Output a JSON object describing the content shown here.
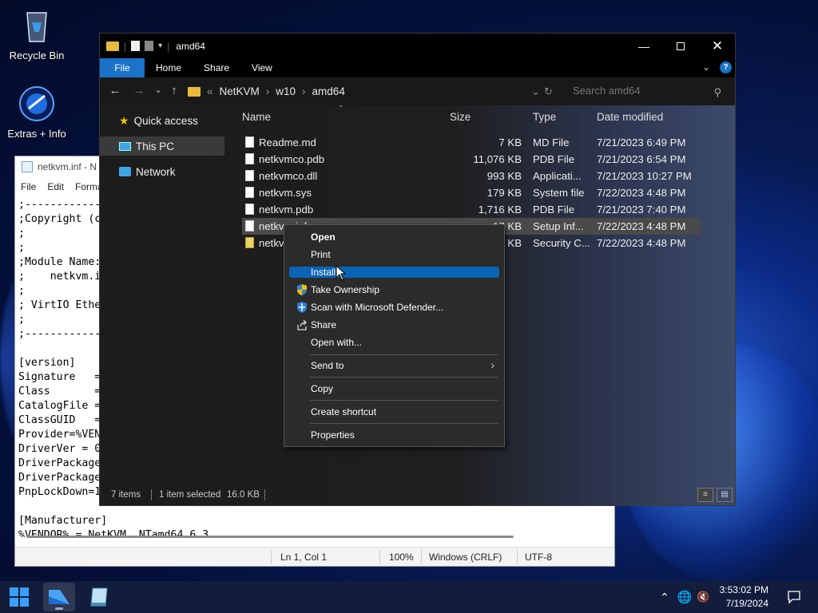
{
  "desktop": {
    "icons": [
      {
        "label": "Recycle Bin"
      },
      {
        "label": "Extras + Info"
      }
    ]
  },
  "notepad": {
    "title": "netkvm.inf - N",
    "menu": [
      "File",
      "Edit",
      "Forma"
    ],
    "lines": [
      ";-------------",
      ";Copyright (c",
      ";",
      ";",
      ";Module Name:",
      ";    netkvm.i",
      ";",
      "; VirtIO Ethe",
      ";",
      ";-------------",
      "",
      "[version]",
      "Signature   =",
      "Class       =",
      "CatalogFile =",
      "ClassGUID   =",
      "Provider=%VEN",
      "DriverVer = 0",
      "DriverPackage",
      "DriverPackage",
      "PnpLockDown=1",
      "",
      "[Manufacturer]",
      "%VENDOR% = NetKVM, NTamd64.6.3"
    ],
    "status": {
      "position": "Ln 1, Col 1",
      "zoom": "100%",
      "line_ending": "Windows (CRLF)",
      "encoding": "UTF-8"
    }
  },
  "explorer": {
    "title": "amd64",
    "ribbon_tabs": [
      "File",
      "Home",
      "Share",
      "View"
    ],
    "breadcrumb": [
      "NetKVM",
      "w10",
      "amd64"
    ],
    "search_placeholder": "Search amd64",
    "nav": [
      {
        "label": "Quick access",
        "icon": "star-icon"
      },
      {
        "label": "This PC",
        "icon": "monitor-icon"
      },
      {
        "label": "Network",
        "icon": "network-icon"
      }
    ],
    "columns": {
      "name": "Name",
      "size": "Size",
      "type": "Type",
      "date": "Date modified"
    },
    "files": [
      {
        "name": "Readme.md",
        "size": "7 KB",
        "type": "MD File",
        "date": "7/21/2023 6:49 PM"
      },
      {
        "name": "netkvmco.pdb",
        "size": "11,076 KB",
        "type": "PDB File",
        "date": "7/21/2023 6:54 PM"
      },
      {
        "name": "netkvmco.dll",
        "size": "993 KB",
        "type": "Applicati...",
        "date": "7/21/2023 10:27 PM"
      },
      {
        "name": "netkvm.sys",
        "size": "179 KB",
        "type": "System file",
        "date": "7/22/2023 4:48 PM"
      },
      {
        "name": "netkvm.pdb",
        "size": "1,716 KB",
        "type": "PDB File",
        "date": "7/21/2023 7:40 PM"
      },
      {
        "name": "netkvm.inf",
        "size": "17 KB",
        "type": "Setup Inf...",
        "date": "7/22/2023 4:48 PM"
      },
      {
        "name": "netkv",
        "size": "KB",
        "type": "Security C...",
        "date": "7/22/2023 4:48 PM"
      }
    ],
    "status": {
      "items": "7 items",
      "selected": "1 item selected",
      "size": "16.0 KB"
    }
  },
  "context_menu": {
    "items": [
      {
        "label": "Open"
      },
      {
        "label": "Print"
      },
      {
        "label": "Install"
      },
      {
        "label": "Take Ownership"
      },
      {
        "label": "Scan with Microsoft Defender..."
      },
      {
        "label": "Share"
      },
      {
        "label": "Open with..."
      },
      {
        "label": "Send to"
      },
      {
        "label": "Copy"
      },
      {
        "label": "Create shortcut"
      },
      {
        "label": "Properties"
      }
    ]
  },
  "taskbar": {
    "time": "3:53:02 PM",
    "date": "7/19/2024"
  },
  "colors": {
    "accent": "#0b63b5",
    "file_tab": "#1a72c9"
  }
}
